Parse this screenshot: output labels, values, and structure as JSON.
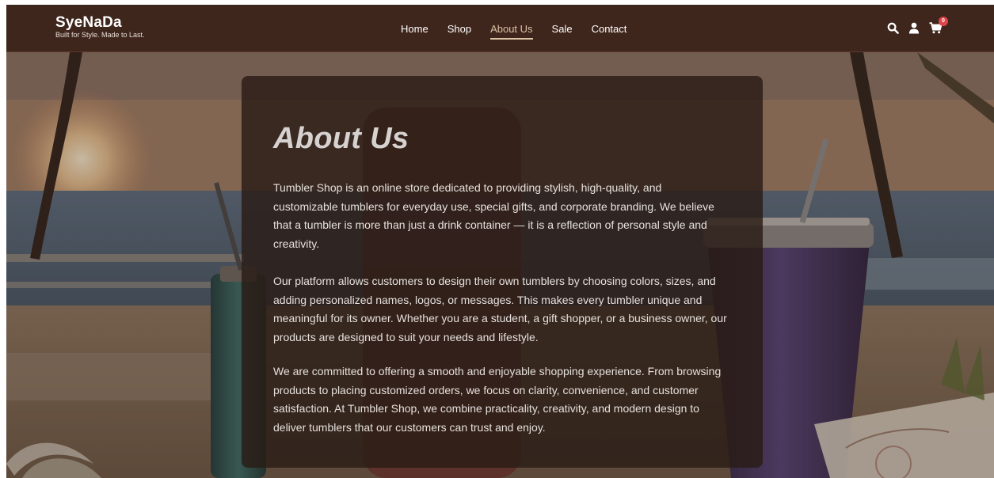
{
  "brand": {
    "name": "SyeNaDa",
    "tagline": "Built for Style. Made to Last."
  },
  "nav": {
    "items": [
      {
        "label": "Home",
        "active": false
      },
      {
        "label": "Shop",
        "active": false
      },
      {
        "label": "About Us",
        "active": true
      },
      {
        "label": "Sale",
        "active": false
      },
      {
        "label": "Contact",
        "active": false
      }
    ]
  },
  "header_icons": {
    "search": "search-icon",
    "account": "user-icon",
    "cart": "cart-icon",
    "cart_count": "0"
  },
  "about": {
    "title": "About Us",
    "paragraphs": [
      "Tumbler Shop is an online store dedicated to providing stylish, high-quality, and customizable tumblers for everyday use, special gifts, and corporate branding. We believe that a tumbler is more than just a drink container — it is a reflection of personal style and creativity.",
      "Our platform allows customers to design their own tumblers by choosing colors, sizes, and adding personalized names, logos, or messages. This makes every tumbler unique and meaningful for its owner. Whether you are a student, a gift shopper, or a business owner, our products are designed to suit your needs and lifestyle.",
      "We are committed to offering a smooth and enjoyable shopping experience. From browsing products to placing customized orders, we focus on clarity, convenience, and customer satisfaction. At Tumbler Shop, we combine practicality, creativity, and modern design to deliver tumblers that our customers can trust and enjoy."
    ]
  },
  "colors": {
    "header_bg": "#3f261c",
    "nav_active": "#d9c3a5",
    "badge": "#e0454a",
    "card_bg": "#2a1c16"
  }
}
